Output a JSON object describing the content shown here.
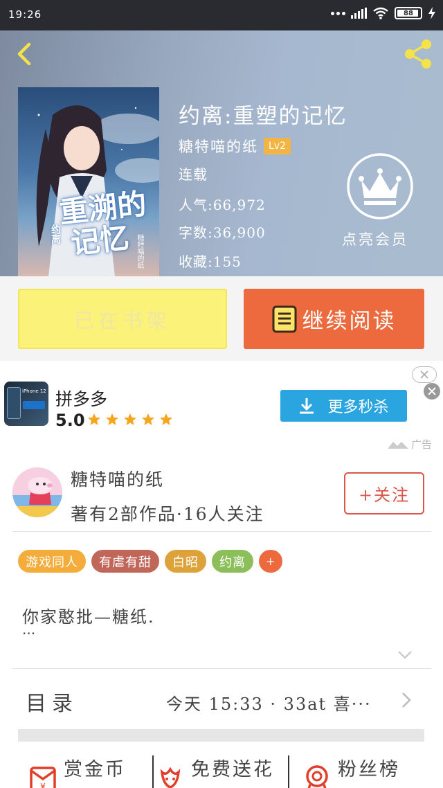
{
  "status_bar": {
    "time": "19:26",
    "battery": "88"
  },
  "book": {
    "title": "约离:重塑的记忆",
    "author": "糖特喵的纸",
    "level": "Lv2",
    "status": "连载",
    "popularity": "人气:66,972",
    "word_count": "字数:36,900",
    "favorites": "收藏:155",
    "cover": {
      "title_line1": "重溯",
      "title_line2": "记忆",
      "title_mid": "的",
      "small": "约离",
      "author": "糖特喵的纸"
    }
  },
  "vip": {
    "label": "点亮会员"
  },
  "buttons": {
    "shelf": "已在书架",
    "read": "继续阅读"
  },
  "ad": {
    "app_name": "拼多多",
    "rating": "5.0",
    "stars": 5,
    "cta": "更多秒杀",
    "tag": "广告",
    "thumb_text": "iPhone 12"
  },
  "author_card": {
    "name": "糖特喵的纸",
    "meta": "著有2部作品·16人关注",
    "follow": "+关注"
  },
  "tags": [
    {
      "label": "游戏同人",
      "color": "#f4ad3b"
    },
    {
      "label": "有虐有甜",
      "color": "#c1675a"
    },
    {
      "label": "白昭",
      "color": "#dda23a"
    },
    {
      "label": "约离",
      "color": "#8cbf5a"
    },
    {
      "label": "+",
      "color": "#ec6a3d"
    }
  ],
  "intro": {
    "text": "你家憨批—糖纸.",
    "more": "···"
  },
  "toc": {
    "label": "目录",
    "latest": "今天 15:33 · 33at 喜···"
  },
  "actions": [
    {
      "label": "赏金币",
      "icon": "coin-envelope-icon"
    },
    {
      "label": "免费送花",
      "icon": "flower-icon"
    },
    {
      "label": "粉丝榜",
      "icon": "medal-icon"
    }
  ],
  "colors": {
    "accent": "#ec6a3d",
    "shelf_button": "#fbf27a",
    "ad_button": "#2aa5df",
    "follow": "#d9564a"
  }
}
